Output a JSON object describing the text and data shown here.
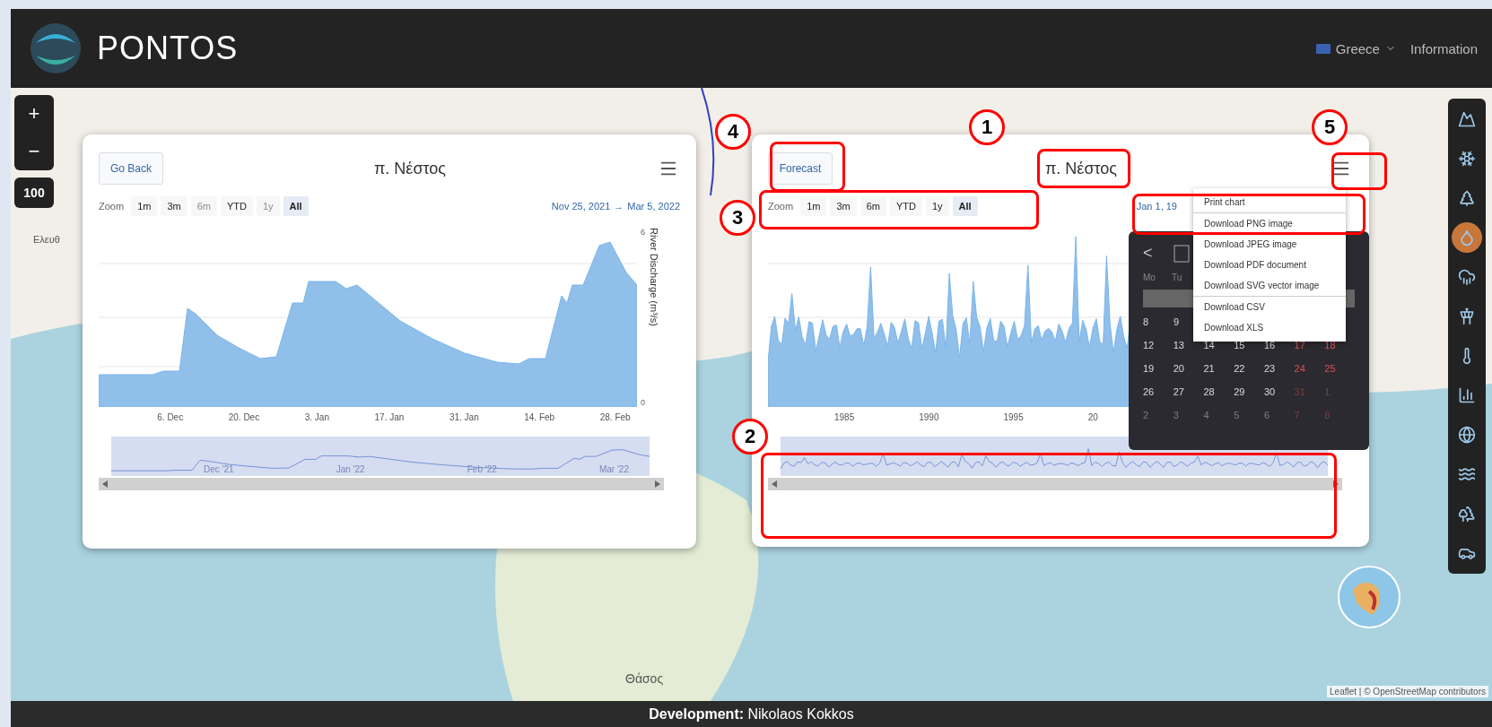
{
  "header": {
    "logo_text": "PONTOS",
    "menu": [
      {
        "kind": "dropdown",
        "label": "Greece"
      },
      {
        "kind": "link",
        "label": "Information"
      }
    ]
  },
  "map_controls": {
    "zoom_in": "+",
    "zoom_out": "−",
    "scale": "100"
  },
  "map_labels": [
    {
      "kind": "place",
      "text": "Ελευθ"
    },
    {
      "kind": "island",
      "text": "Θάσος"
    },
    {
      "kind": "attribution",
      "text": "Leaflet | © OpenStreetMap contributors"
    }
  ],
  "layer_tools": [
    {
      "selected": false
    },
    {
      "selected": false
    },
    {
      "selected": false
    },
    {
      "selected": true
    },
    {
      "selected": false
    },
    {
      "selected": false
    },
    {
      "selected": false
    },
    {
      "selected": false
    },
    {
      "selected": false
    },
    {
      "selected": false
    },
    {
      "selected": false
    },
    {
      "selected": false
    }
  ],
  "panels": [
    {
      "button": "Go Back",
      "title": "π. Νέστος",
      "zoom_label": "Zoom",
      "ranges": [
        {
          "label": "1m",
          "selected": false,
          "disabled": false
        },
        {
          "label": "3m",
          "selected": false,
          "disabled": false
        },
        {
          "label": "6m",
          "selected": false,
          "disabled": true
        },
        {
          "label": "YTD",
          "selected": false,
          "disabled": false
        },
        {
          "label": "1y",
          "selected": false,
          "disabled": true
        },
        {
          "label": "All",
          "selected": true,
          "disabled": false
        }
      ],
      "date_from": "Nov 25, 2021",
      "date_sep": "→",
      "date_to": "Mar 5, 2022",
      "y_label": "River Discharge (m³/s)",
      "y_ticks": [
        "6",
        "0"
      ],
      "x_labels": [
        "6. Dec",
        "20. Dec",
        "3. Jan",
        "17. Jan",
        "31. Jan",
        "14. Feb",
        "28. Feb"
      ],
      "navigator_labels": [
        "Dec '21",
        "Jan '22",
        "Feb '22",
        "Mar '22"
      ]
    },
    {
      "button": "Forecast",
      "title": "π. Νέστος",
      "zoom_label": "Zoom",
      "ranges": [
        {
          "label": "1m",
          "selected": false,
          "disabled": false
        },
        {
          "label": "3m",
          "selected": false,
          "disabled": false
        },
        {
          "label": "6m",
          "selected": false,
          "disabled": false
        },
        {
          "label": "YTD",
          "selected": false,
          "disabled": false
        },
        {
          "label": "1y",
          "selected": false,
          "disabled": false
        },
        {
          "label": "All",
          "selected": true,
          "disabled": false
        }
      ],
      "date_from": "Jan 1, 19",
      "x_labels": [
        "1985",
        "1990",
        "1995",
        "20"
      ]
    }
  ],
  "export_menu": [
    {
      "label": "Print chart",
      "divider": true
    },
    {
      "label": "Download PNG image",
      "divider": false
    },
    {
      "label": "Download JPEG image",
      "divider": false
    },
    {
      "label": "Download PDF document",
      "divider": false
    },
    {
      "label": "Download SVG vector image",
      "divider": true
    },
    {
      "label": "Download CSV",
      "divider": false
    },
    {
      "label": "Download XLS",
      "divider": false
    }
  ],
  "calendar": {
    "prev": "<",
    "weekdays": [
      "Mo",
      "Tu"
    ],
    "rows": [
      [
        {
          "d": "8",
          "muted": false
        },
        {
          "d": "9",
          "muted": false
        }
      ],
      [
        {
          "d": "12",
          "muted": false
        },
        {
          "d": "13",
          "muted": false
        },
        {
          "d": "14",
          "muted": false
        },
        {
          "d": "15",
          "muted": false
        },
        {
          "d": "16",
          "muted": false
        },
        {
          "d": "17",
          "muted": false
        },
        {
          "d": "18",
          "muted": false
        }
      ],
      [
        {
          "d": "19",
          "muted": false
        },
        {
          "d": "20",
          "muted": false
        },
        {
          "d": "21",
          "muted": false
        },
        {
          "d": "22",
          "muted": false
        },
        {
          "d": "23",
          "muted": false
        },
        {
          "d": "24",
          "muted": false
        },
        {
          "d": "25",
          "muted": false
        }
      ],
      [
        {
          "d": "26",
          "muted": false
        },
        {
          "d": "27",
          "muted": false
        },
        {
          "d": "28",
          "muted": false
        },
        {
          "d": "29",
          "muted": false
        },
        {
          "d": "30",
          "muted": false
        },
        {
          "d": "31",
          "muted": true
        },
        {
          "d": "1",
          "muted": true
        }
      ],
      [
        {
          "d": "2",
          "muted": true
        },
        {
          "d": "3",
          "muted": true
        },
        {
          "d": "4",
          "muted": true
        },
        {
          "d": "5",
          "muted": true
        },
        {
          "d": "6",
          "muted": true
        },
        {
          "d": "7",
          "muted": true
        },
        {
          "d": "8",
          "muted": true
        }
      ]
    ]
  },
  "annotations": [
    {
      "label": "4"
    },
    {
      "label": "1"
    },
    {
      "label": "5"
    },
    {
      "label": "3"
    },
    {
      "label": "2"
    }
  ],
  "footer": {
    "text": "**Development:** Nikolaos Kokkos"
  }
}
